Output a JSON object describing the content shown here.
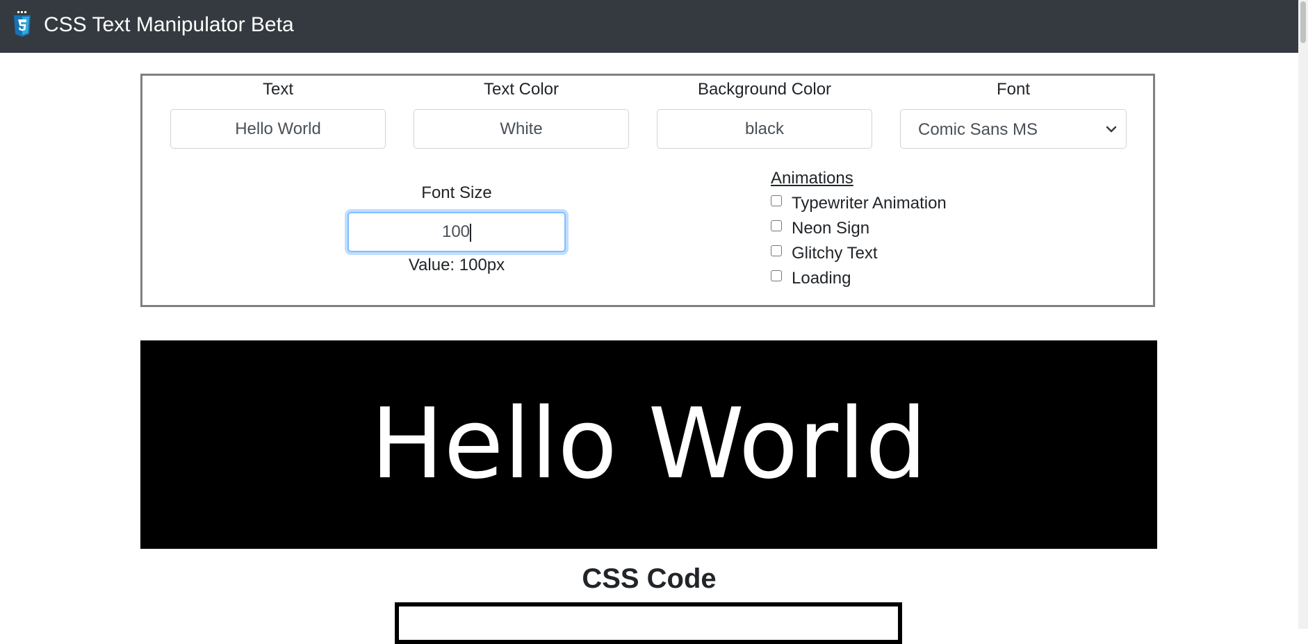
{
  "header": {
    "app_title": "CSS Text Manipulator Beta",
    "logo_icon": "css3-icon"
  },
  "controls": {
    "text": {
      "label": "Text",
      "value": "Hello World"
    },
    "text_color": {
      "label": "Text Color",
      "value": "White"
    },
    "background_color": {
      "label": "Background Color",
      "value": "black"
    },
    "font": {
      "label": "Font",
      "selected": "Comic Sans MS"
    },
    "font_size": {
      "label": "Font Size",
      "value": "100",
      "value_text": "Value: 100px"
    },
    "animations": {
      "title": "Animations",
      "items": [
        {
          "label": "Typewriter Animation",
          "checked": false
        },
        {
          "label": "Neon Sign",
          "checked": false
        },
        {
          "label": "Glitchy Text",
          "checked": false
        },
        {
          "label": "Loading",
          "checked": false
        }
      ]
    }
  },
  "preview": {
    "text": "Hello World",
    "text_color": "#ffffff",
    "background_color": "#000000"
  },
  "code_section": {
    "heading": "CSS Code"
  },
  "colors": {
    "navbar": "#343a40",
    "focus_ring": "#80bdff"
  }
}
